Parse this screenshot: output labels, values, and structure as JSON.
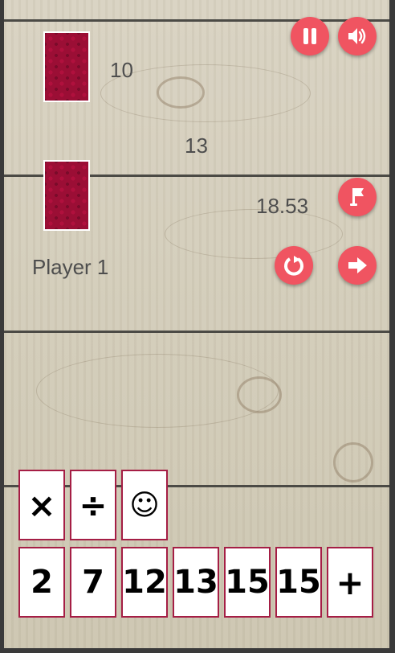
{
  "opponent": {
    "card_count": "10"
  },
  "target": "13",
  "player": {
    "name": "Player 1",
    "timer": "18.53"
  },
  "buttons": {
    "pause": "pause-icon",
    "sound": "speaker-icon",
    "flag": "flag-icon",
    "undo": "undo-icon",
    "next": "arrow-right-icon"
  },
  "operators": [
    "×",
    "÷",
    "☺"
  ],
  "hand": [
    "2",
    "7",
    "12",
    "13",
    "15",
    "15",
    "+"
  ]
}
